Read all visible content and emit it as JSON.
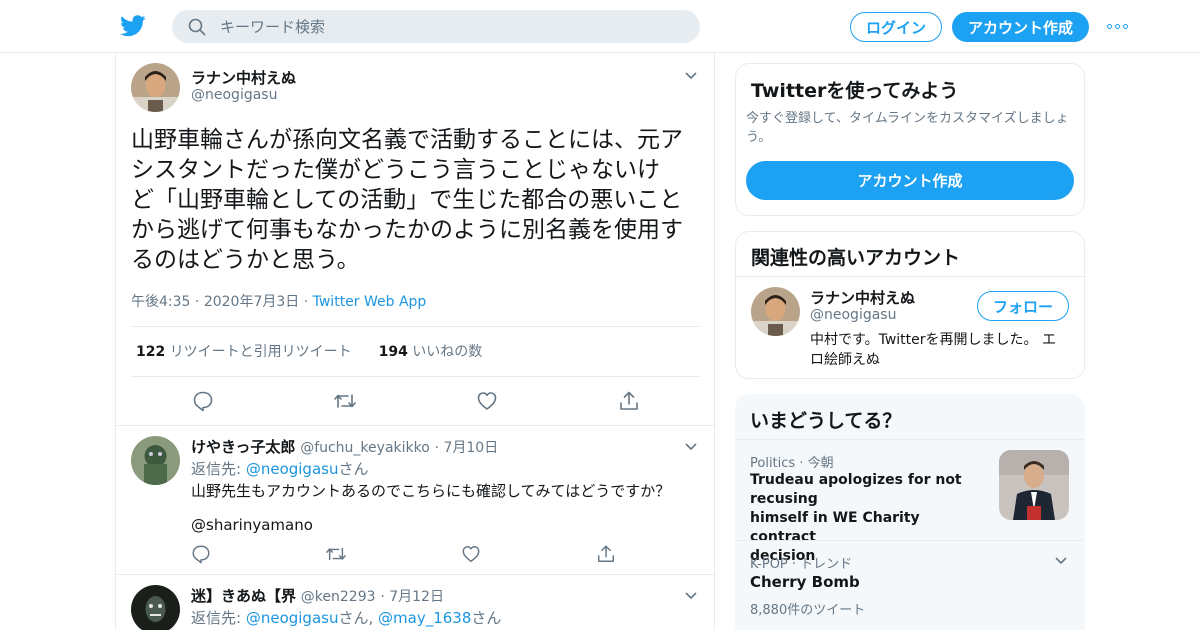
{
  "header": {
    "search_placeholder": "キーワード検索",
    "login_label": "ログイン",
    "signup_label": "アカウント作成"
  },
  "tweet": {
    "name": "ラナン中村えぬ",
    "handle": "@neogigasu",
    "text_lines": [
      "山野車輪さんが孫向文名義で活動することには、元ア",
      "シスタントだった僕がどうこう言うことじゃないけ",
      "ど「山野車輪としての活動」で生じた都合の悪いこと",
      "から逃げて何事もなかったかのように別名義を使用す",
      "るのはどうかと思う。"
    ],
    "time": "午後4:35",
    "date": "2020年7月3日",
    "source": "Twitter Web App",
    "retweet_count": "122",
    "retweet_label": "リツイートと引用リツイート",
    "like_count": "194",
    "like_label": "いいねの数"
  },
  "replies": [
    {
      "name": "けやきっ子太郎",
      "handle": "@fuchu_keyakikko",
      "date": "7月10日",
      "reply_prefix": "返信先: ",
      "reply_to": "@neogigasu",
      "reply_suffix": "さん",
      "text": "山野先生もアカウントあるのでこちらにも確認してみてはどうですか？",
      "mention": "@sharinyamano"
    },
    {
      "name": "迷】きあぬ【界",
      "handle": "@ken2293",
      "date": "7月12日",
      "reply_prefix": "返信先: ",
      "reply_to": "@neogigasu",
      "reply_mid": "さん, ",
      "reply_to2": "@may_1638",
      "reply_suffix": "さん"
    }
  ],
  "sidebar": {
    "signup_card": {
      "title": "Twitterを使ってみよう",
      "desc_line1": "今すぐ登録して、タイムラインをカスタマイズしましょ",
      "desc_line2": "う。",
      "button": "アカウント作成"
    },
    "related": {
      "title": "関連性の高いアカウント",
      "name": "ラナン中村えぬ",
      "handle": "@neogigasu",
      "follow_label": "フォロー",
      "bio_line1": "中村です。Twitterを再開しました。 エ",
      "bio_line2": "ロ絵師えぬ"
    },
    "trends": {
      "title": "いまどうしてる？",
      "items": [
        {
          "category": "Politics",
          "time": "今朝",
          "headline_line1": "Trudeau apologizes for not recusing",
          "headline_line2": "himself in WE Charity contract",
          "headline_line3": "decision"
        },
        {
          "category": "K-POP",
          "time": "トレンド",
          "topic": "Cherry Bomb",
          "count": "8,880件のツイート"
        }
      ]
    }
  },
  "colors": {
    "accent": "#1da1f2",
    "link": "#1b95e0",
    "secondary_text": "#657786",
    "border": "#e6ecf0"
  }
}
